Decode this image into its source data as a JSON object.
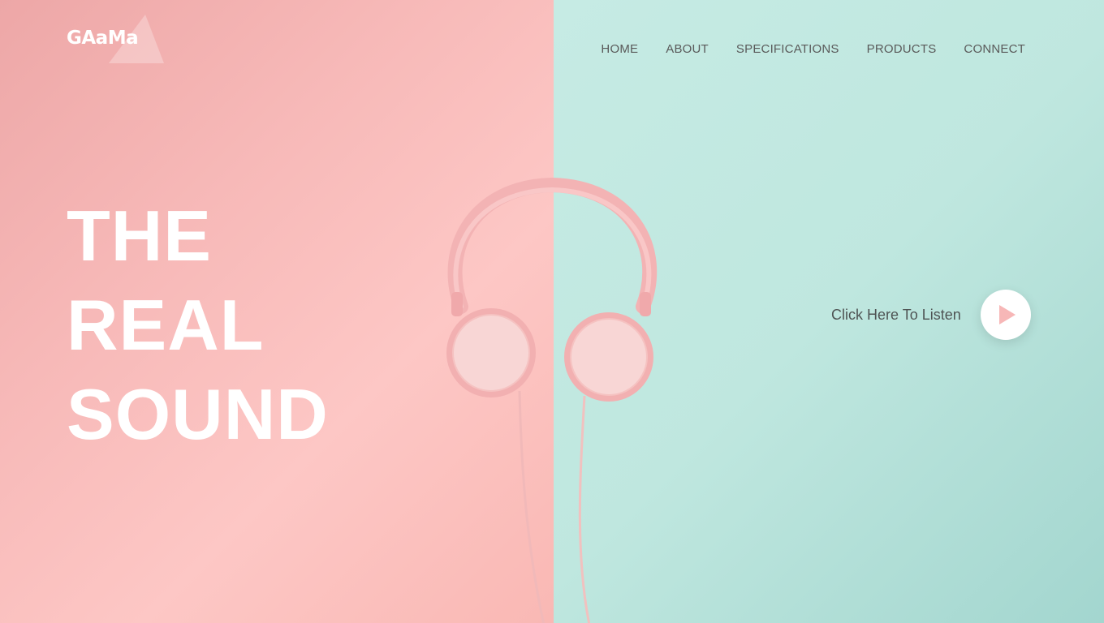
{
  "brand": {
    "logo_text": "GAaMa"
  },
  "nav": {
    "items": [
      {
        "label": "HOME"
      },
      {
        "label": "ABOUT"
      },
      {
        "label": "SPECIFICATIONS"
      },
      {
        "label": "PRODUCTS"
      },
      {
        "label": "CONNECT"
      }
    ]
  },
  "hero": {
    "line1": "THE",
    "line2": "REAL",
    "line3": "SOUND"
  },
  "cta": {
    "label": "Click Here To Listen",
    "icon": "play-icon"
  },
  "colors": {
    "pink_panel": "#f9bdbb",
    "mint_panel": "#c2e8e1",
    "play_icon": "#f7b7b7",
    "text_dark": "#5a5a5a"
  }
}
